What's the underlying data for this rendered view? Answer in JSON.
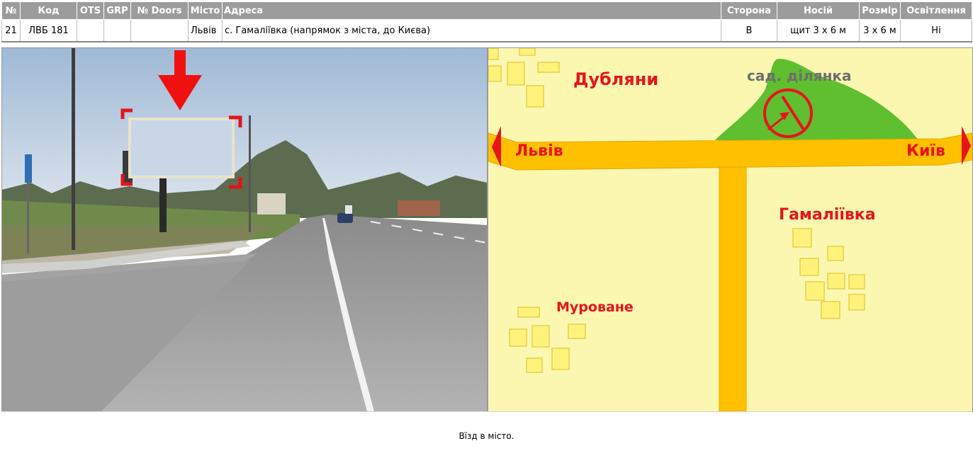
{
  "table": {
    "headers": {
      "num": "№",
      "code": "Код",
      "ots": "OTS",
      "grp": "GRP",
      "doors": "№ Doors",
      "city": "Місто",
      "address": "Адреса",
      "side": "Сторона",
      "carrier": "Носій",
      "size": "Розмір",
      "lighting": "Освітлення"
    },
    "row": {
      "num": "21",
      "code": "ЛВБ 181",
      "ots": "",
      "grp": "",
      "doors": "",
      "city": "Львів",
      "address": "с. Гамаліївка (напрямок з міста, до Києва)",
      "side": "В",
      "carrier": "щит 3 х 6 м",
      "size": "3 х 6 м",
      "lighting": "Ні"
    }
  },
  "map": {
    "labels": {
      "dubliany": "Дубляни",
      "garden": "сад. ділянка",
      "lviv": "Львів",
      "kyiv": "Київ",
      "gamaliivka": "Гамаліївка",
      "murovane": "Муроване"
    },
    "colors": {
      "background": "#fbf7b0",
      "road": "#ffc000",
      "label": "#e8141c",
      "garden": "#5fbf2f",
      "house": "#fff27a"
    }
  },
  "footer": {
    "note": "Вїзд в місто."
  }
}
